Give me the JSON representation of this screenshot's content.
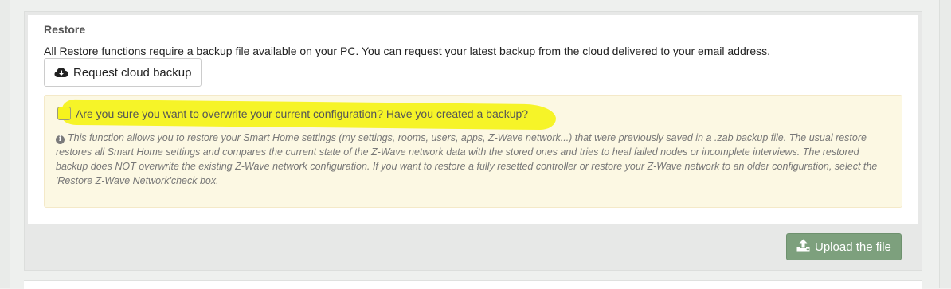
{
  "restore": {
    "title": "Restore",
    "intro": "All Restore functions require a backup file available on your PC. You can request your latest backup from the cloud delivered to your email address.",
    "cloud_button": {
      "label": "Request cloud backup",
      "icon": "cloud-download-icon"
    },
    "warning": {
      "confirm_label": "Are you sure you want to overwrite your current configuration? Have you created a backup?",
      "confirm_checked": false,
      "info_icon": "info-circle-icon",
      "info_text": "This function allows you to restore your Smart Home settings (my settings, rooms, users, apps, Z-Wave network...) that were previously saved in a .zab backup file. The usual restore restores all Smart Home settings and compares the current state of the Z-Wave network data with the stored ones and tries to heal failed nodes or incomplete interviews. The restored backup does NOT overwrite the existing Z-Wave network configuration. If you want to restore a fully resetted controller or restore your Z-Wave network to an older configuration, select the 'Restore Z-Wave Network'check box.",
      "highlight_color": "#f6f31d",
      "background_color": "#fcf8e3"
    },
    "upload_button": {
      "label": "Upload the file",
      "icon": "upload-icon",
      "color": "#7da07d"
    }
  }
}
